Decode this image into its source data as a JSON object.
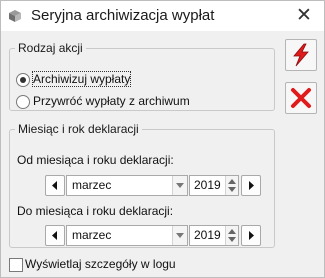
{
  "window": {
    "title": "Seryjna archiwizacja wypłat",
    "close_label": "✕"
  },
  "action_group": {
    "legend": "Rodzaj akcji",
    "options": [
      {
        "label": "Archiwizuj wypłaty",
        "checked": true
      },
      {
        "label": "Przywróć wypłaty z archiwum",
        "checked": false
      }
    ]
  },
  "period_group": {
    "legend": "Miesiąc i rok deklaracji",
    "from": {
      "label": "Od miesiąca i roku deklaracji:",
      "month": "marzec",
      "year": "2019"
    },
    "to": {
      "label": "Do miesiąca i roku deklaracji:",
      "month": "marzec",
      "year": "2019"
    }
  },
  "details_checkbox": {
    "label": "Wyświetlaj szczegóły w logu",
    "checked": false
  },
  "buttons": {
    "run_icon": "lightning-icon",
    "cancel_icon": "red-x-icon"
  },
  "colors": {
    "accent_red": "#e01b1b"
  }
}
